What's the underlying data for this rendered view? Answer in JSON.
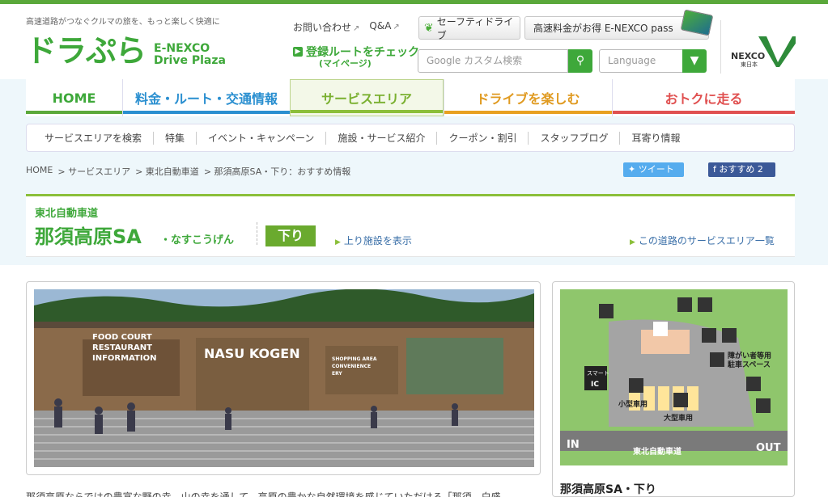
{
  "header": {
    "tagline": "高速道路がつなぐクルマの旅を、もっと楽しく快適に",
    "logo_jp": "ドラぷら",
    "logo_en_line1": "E-NEXCO",
    "logo_en_line2": "Drive Plaza",
    "contact_label": "お問い合わせ",
    "qa_label": "Q&A",
    "safety_button": "セーフティドライブ",
    "pass_button": "高速料金がお得 E-NEXCO pass",
    "route_check_label": "登録ルートをチェック",
    "route_check_sub": "(マイページ)",
    "search_placeholder": "Google カスタム検索",
    "language_label": "Language",
    "nexco_brand": "NEXCO",
    "nexco_sub": "東日本"
  },
  "main_nav": [
    {
      "label": "HOME",
      "color": "#5aa83a"
    },
    {
      "label": "料金・ルート・交通情報",
      "color": "#2a8fd0"
    },
    {
      "label": "サービスエリア",
      "color": "#8bbf3a"
    },
    {
      "label": "ドライブを楽しむ",
      "color": "#e8a020"
    },
    {
      "label": "おトクに走る",
      "color": "#e05050"
    }
  ],
  "sub_nav": [
    "サービスエリアを検索",
    "特集",
    "イベント・キャンペーン",
    "施設・サービス紹介",
    "クーポン・割引",
    "スタッフブログ",
    "耳寄り情報"
  ],
  "breadcrumb": [
    "HOME",
    "> サービスエリア",
    "> 東北自動車道",
    "> 那須高原SA・下り：おすすめ情報"
  ],
  "social": {
    "tweet": "ツイート",
    "fb": "おすすめ 2"
  },
  "sa": {
    "road": "東北自動車道",
    "name": "那須高原SA",
    "kana": "・なすこうげん",
    "direction": "下り",
    "link_up": "上り施設を表示",
    "link_list": "この道路のサービスエリア一覧"
  },
  "photo": {
    "sign_main": "NASU KOGEN",
    "sign_left1": "FOOD COURT",
    "sign_left2": "RESTAURANT",
    "sign_left3": "INFORMATION",
    "sign_right1": "SHOPPING AREA",
    "sign_right2": "CONVENIENCE",
    "sign_right3": "ERY"
  },
  "map": {
    "label_disabled": "障がい者等用",
    "label_disabled2": "駐車スペース",
    "label_small": "小型車用",
    "label_large": "大型車用",
    "label_smart": "スマート",
    "label_ic": "IC",
    "label_in": "IN",
    "label_out": "OUT",
    "label_road": "東北自動車道",
    "title": "那須高原SA・下り"
  },
  "description": "那須高原ならではの豊富な野の幸、山の幸を通して、高原の豊かな自然環境を感じていただける「那須　白盛"
}
